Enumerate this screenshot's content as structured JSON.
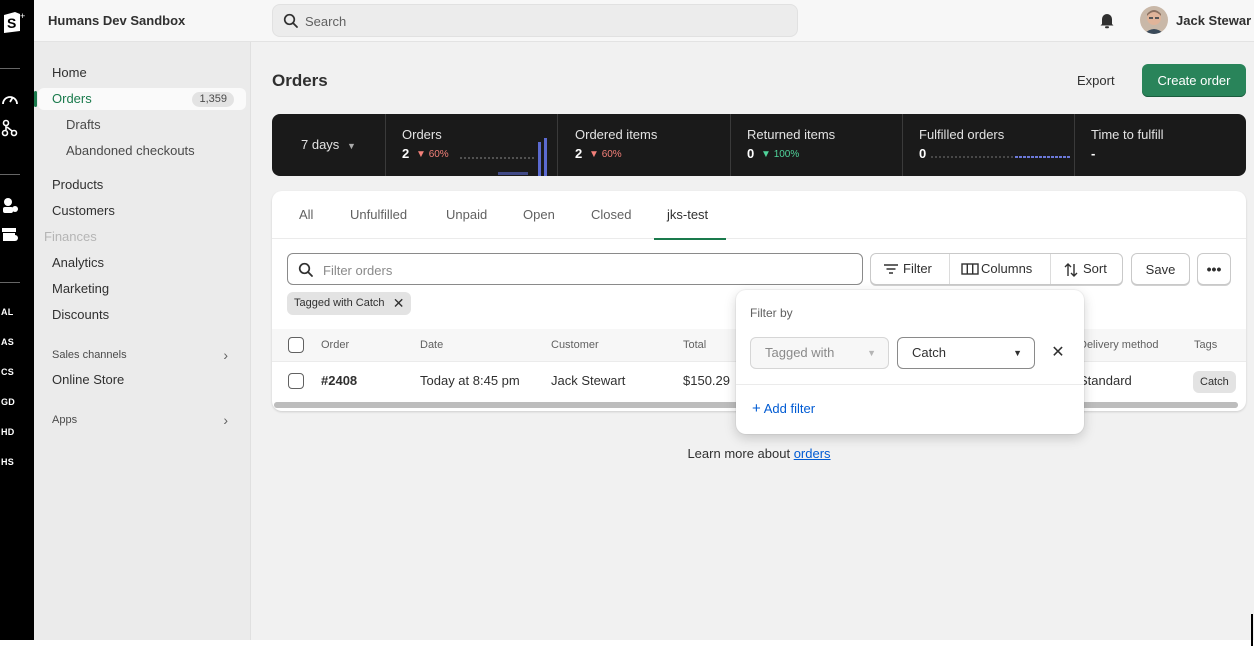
{
  "topbar": {
    "store_name": "Humans Dev Sandbox",
    "search_placeholder": "Search",
    "user_name": "Jack Stewar"
  },
  "rail": {
    "abbrs": [
      "AL",
      "AS",
      "CS",
      "GD",
      "HD",
      "HS"
    ]
  },
  "sidebar": {
    "home": "Home",
    "orders": "Orders",
    "orders_count": "1,359",
    "drafts": "Drafts",
    "abandoned": "Abandoned checkouts",
    "products": "Products",
    "customers": "Customers",
    "finances": "Finances",
    "analytics": "Analytics",
    "marketing": "Marketing",
    "discounts": "Discounts",
    "sales_channels": "Sales channels",
    "online_store": "Online Store",
    "apps": "Apps"
  },
  "page": {
    "title": "Orders",
    "export": "Export",
    "create": "Create order"
  },
  "metrics": {
    "period": "7 days",
    "items": [
      {
        "label": "Orders",
        "value": "2",
        "delta": "60%",
        "delta_color": "#f48079"
      },
      {
        "label": "Ordered items",
        "value": "2",
        "delta": "60%",
        "delta_color": "#f48079"
      },
      {
        "label": "Returned items",
        "value": "0",
        "delta": "100%",
        "delta_color": "#4fd39a"
      },
      {
        "label": "Fulfilled orders",
        "value": "0",
        "delta": "",
        "delta_color": ""
      },
      {
        "label": "Time to fulfill",
        "value": "-",
        "delta": "",
        "delta_color": ""
      }
    ]
  },
  "tabs": [
    "All",
    "Unfulfilled",
    "Unpaid",
    "Open",
    "Closed",
    "jks-test"
  ],
  "toolbar": {
    "filter_placeholder": "Filter orders",
    "filter": "Filter",
    "columns": "Columns",
    "sort": "Sort",
    "save": "Save",
    "more": "•••"
  },
  "chip": {
    "label": "Tagged with Catch"
  },
  "table": {
    "headers": {
      "order": "Order",
      "date": "Date",
      "customer": "Customer",
      "total": "Total",
      "delivery": "Delivery method",
      "tags": "Tags"
    },
    "row": {
      "order": "#2408",
      "date": "Today at 8:45 pm",
      "customer": "Jack Stewart",
      "total": "$150.29",
      "delivery": "Standard",
      "tag": "Catch"
    }
  },
  "learn": {
    "prefix": "Learn more about ",
    "link": "orders"
  },
  "popover": {
    "title": "Filter by",
    "field": "Tagged with",
    "value": "Catch",
    "add": "Add filter"
  },
  "colors": {
    "accent_green": "#29845a",
    "link_blue": "#005bd3",
    "metrics_bg": "#1a1a1a"
  }
}
